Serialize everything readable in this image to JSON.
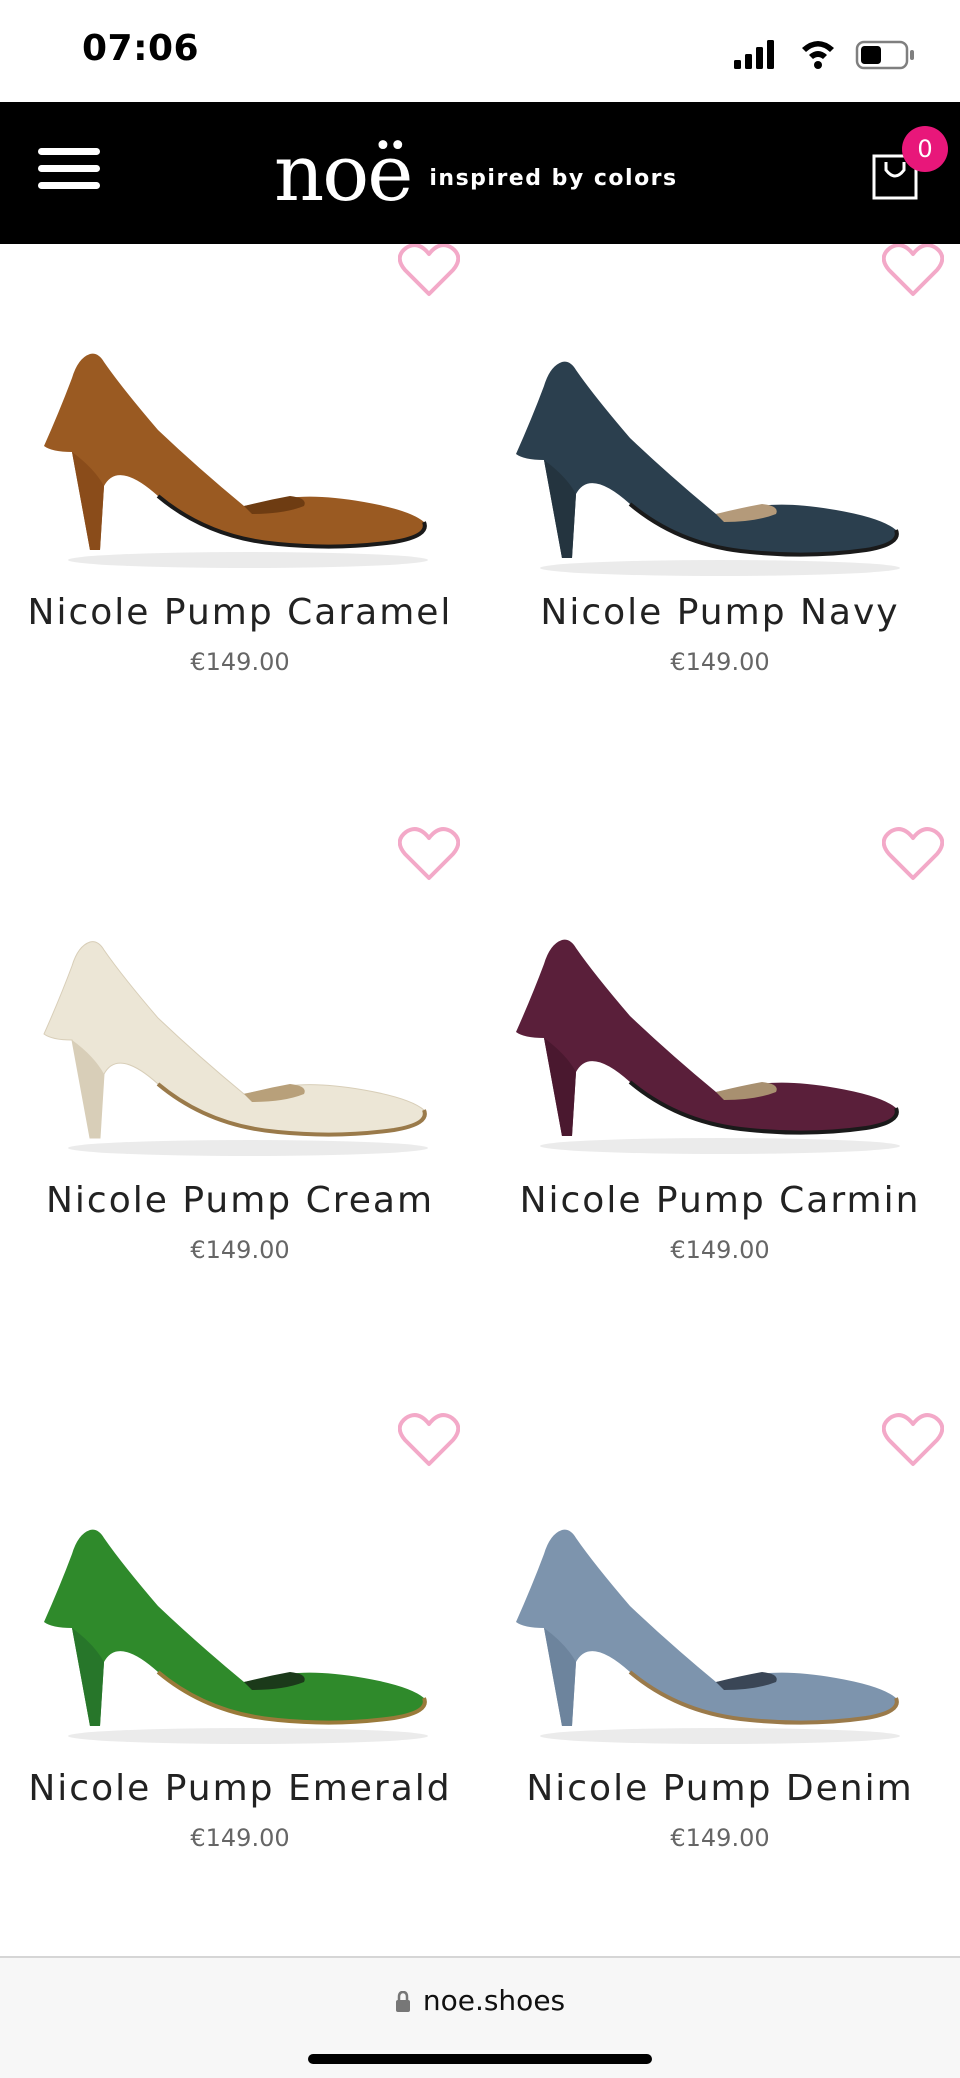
{
  "status_bar": {
    "time": "07:06",
    "icons": [
      "signal-icon",
      "wifi-icon",
      "battery-icon"
    ]
  },
  "header": {
    "menu_icon": "hamburger-menu-icon",
    "logo_text": "noë",
    "tagline": "inspired by colors",
    "cart_icon": "shopping-bag-icon",
    "cart_count": "0"
  },
  "products": [
    {
      "name": "Nicole Pump Caramel",
      "price": "€149.00",
      "color": "#9a5a22",
      "color_dark": "#6e3c12",
      "heel": "#8a4c1a"
    },
    {
      "name": "Nicole Pump Navy",
      "price": "€149.00",
      "color": "#2b3f4e",
      "color_dark": "#17242e",
      "heel": "#24343f"
    },
    {
      "name": "Nicole Pump Cream",
      "price": "€149.00",
      "color": "#ece6d6",
      "color_dark": "#c9bfa5",
      "heel": "#d8ceb8"
    },
    {
      "name": "Nicole Pump Carmin",
      "price": "€149.00",
      "color": "#5a1f3a",
      "color_dark": "#34101f",
      "heel": "#4a182f"
    },
    {
      "name": "Nicole Pump Emerald",
      "price": "€149.00",
      "color": "#2f8a2b",
      "color_dark": "#1b5e1a",
      "heel": "#27762a"
    },
    {
      "name": "Nicole Pump Denim",
      "price": "€149.00",
      "color": "#7d94ad",
      "color_dark": "#5c7189",
      "heel": "#6d849d"
    }
  ],
  "colors": {
    "header_bg": "#000000",
    "badge": "#e8177a",
    "favorite_outline": "#f3a9c8"
  },
  "bottom_bar": {
    "lock_icon": "lock-icon",
    "url": "noe.shoes"
  }
}
